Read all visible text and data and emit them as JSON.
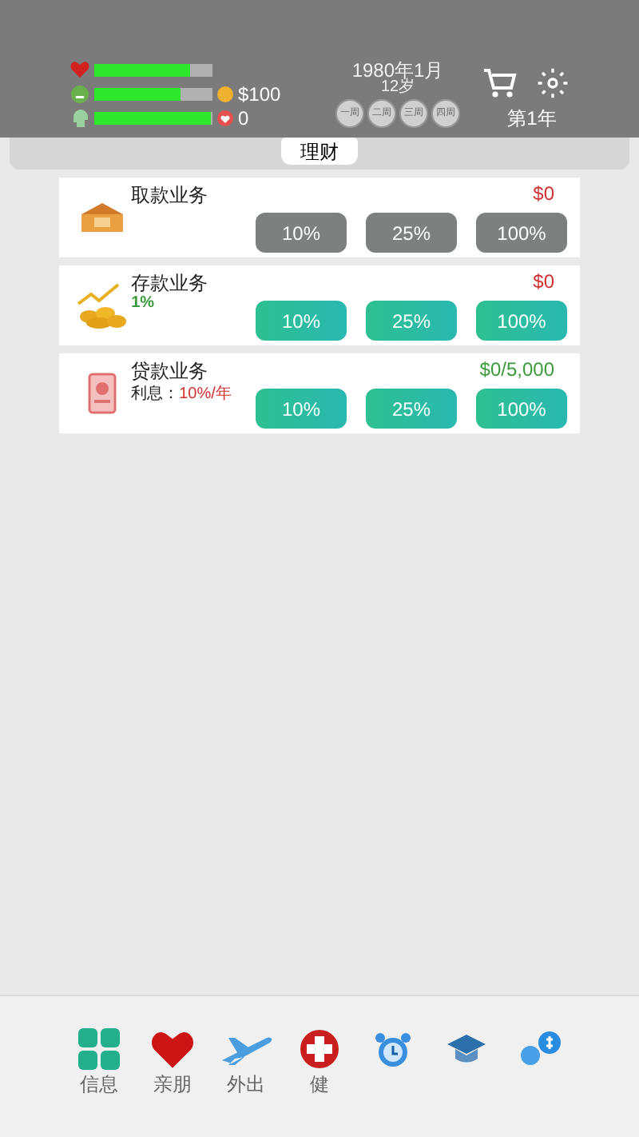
{
  "stats": [
    {
      "kind": "health",
      "level": 0.81
    },
    {
      "kind": "mood",
      "level": 0.73,
      "value": {
        "kind": "money",
        "text": "$100"
      }
    },
    {
      "kind": "mind",
      "level": 0.98,
      "value": {
        "kind": "heart",
        "text": "0"
      }
    }
  ],
  "date": "1980年1月",
  "age": "12岁",
  "weeks": [
    "一周",
    "二周",
    "三周",
    "四周"
  ],
  "year": "第1年",
  "tab": {
    "label": "理财",
    "selected": true
  },
  "cards": [
    {
      "kind": "withdraw",
      "title": "取款业务",
      "amount": {
        "text": "$0",
        "color": "#d32f2f"
      },
      "buttons": [
        {
          "label": "10%",
          "disabled": true
        },
        {
          "label": "25%",
          "disabled": true
        },
        {
          "label": "100%",
          "disabled": true
        }
      ]
    },
    {
      "kind": "deposit",
      "title": "存款业务",
      "rate": "1%",
      "amount": {
        "text": "$0",
        "color": "#d32f2f"
      },
      "buttons": [
        {
          "label": "10%",
          "disabled": false
        },
        {
          "label": "25%",
          "disabled": false
        },
        {
          "label": "100%",
          "disabled": false
        }
      ]
    },
    {
      "kind": "loan",
      "title": "贷款业务",
      "interest_label": "利息：",
      "interest": "10%/年",
      "amount": {
        "text": "$0/5,000",
        "color": "#3a9a3a"
      },
      "buttons": [
        {
          "label": "10%",
          "disabled": false
        },
        {
          "label": "25%",
          "disabled": false
        },
        {
          "label": "100%",
          "disabled": false
        }
      ]
    }
  ],
  "nav": [
    {
      "kind": "info",
      "label": "信息"
    },
    {
      "kind": "friends",
      "label": "亲朋"
    },
    {
      "kind": "travel",
      "label": "外出"
    },
    {
      "kind": "health",
      "label": "健"
    },
    {
      "kind": "clock"
    },
    {
      "kind": "school"
    },
    {
      "kind": "money"
    }
  ]
}
